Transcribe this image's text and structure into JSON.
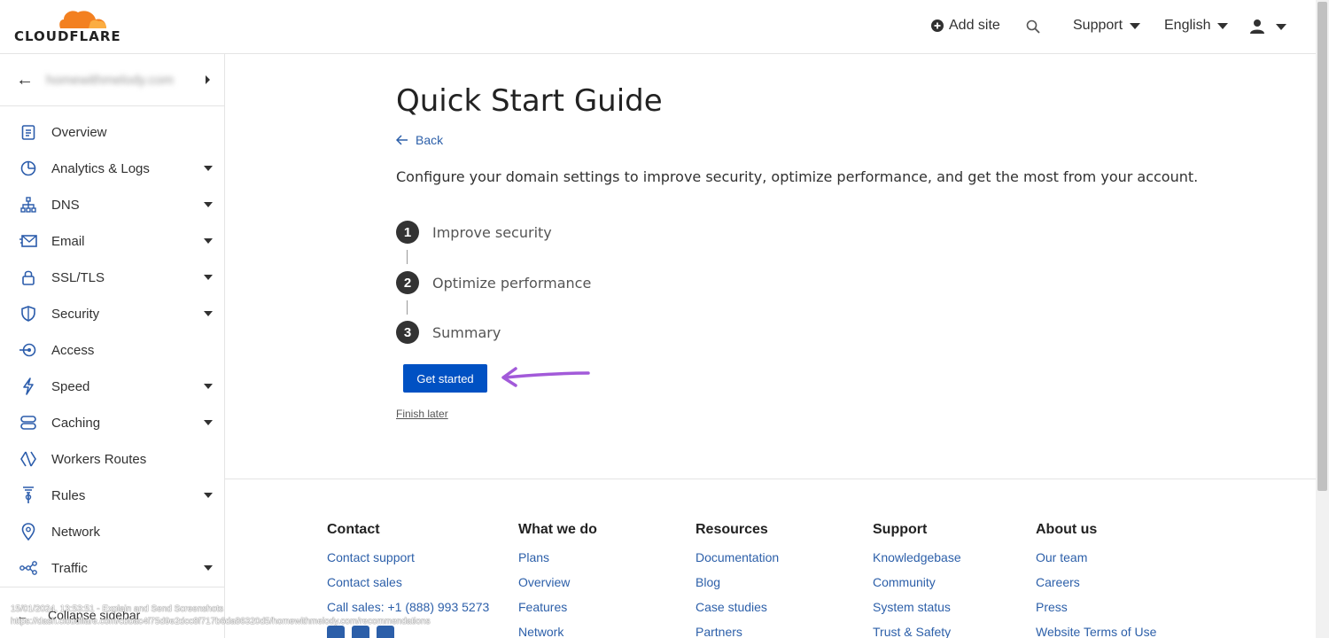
{
  "header": {
    "logo_text": "CLOUDFLARE",
    "add_site": "Add site",
    "support": "Support",
    "language": "English"
  },
  "sidebar": {
    "account_name": "homewithmelody.com",
    "items": [
      {
        "label": "Overview",
        "icon": "clipboard-icon",
        "has_caret": false
      },
      {
        "label": "Analytics & Logs",
        "icon": "pie-chart-icon",
        "has_caret": true
      },
      {
        "label": "DNS",
        "icon": "network-tree-icon",
        "has_caret": true
      },
      {
        "label": "Email",
        "icon": "envelope-icon",
        "has_caret": true
      },
      {
        "label": "SSL/TLS",
        "icon": "lock-icon",
        "has_caret": true
      },
      {
        "label": "Security",
        "icon": "shield-icon",
        "has_caret": true
      },
      {
        "label": "Access",
        "icon": "access-icon",
        "has_caret": false
      },
      {
        "label": "Speed",
        "icon": "lightning-icon",
        "has_caret": true
      },
      {
        "label": "Caching",
        "icon": "server-icon",
        "has_caret": true
      },
      {
        "label": "Workers Routes",
        "icon": "diamond-icon",
        "has_caret": false
      },
      {
        "label": "Rules",
        "icon": "funnel-icon",
        "has_caret": true
      },
      {
        "label": "Network",
        "icon": "map-pin-icon",
        "has_caret": false
      },
      {
        "label": "Traffic",
        "icon": "share-nodes-icon",
        "has_caret": true
      }
    ],
    "collapse_label": "Collapse sidebar"
  },
  "watermark": {
    "line1": "15/01/2024, 13:53:51 - Explain and Send Screenshots",
    "line2": "https://dash.cloudflare.com/cbbac4f75d9e2dcc8f717b6da86320d5/homewithmelody.com/recommendations"
  },
  "main": {
    "title": "Quick Start Guide",
    "back_label": "Back",
    "intro": "Configure your domain settings to improve security, optimize performance, and get the most from your account.",
    "steps": [
      {
        "num": "1",
        "label": "Improve security"
      },
      {
        "num": "2",
        "label": "Optimize performance"
      },
      {
        "num": "3",
        "label": "Summary"
      }
    ],
    "get_started": "Get started",
    "finish_later": "Finish later",
    "annotation_arrow_color": "#a25ad9"
  },
  "footer": {
    "columns": [
      {
        "heading": "Contact",
        "links": [
          "Contact support",
          "Contact sales",
          "Call sales: +1 (888) 993 5273"
        ]
      },
      {
        "heading": "What we do",
        "links": [
          "Plans",
          "Overview",
          "Features",
          "Network"
        ]
      },
      {
        "heading": "Resources",
        "links": [
          "Documentation",
          "Blog",
          "Case studies",
          "Partners"
        ]
      },
      {
        "heading": "Support",
        "links": [
          "Knowledgebase",
          "Community",
          "System status",
          "Trust & Safety"
        ]
      },
      {
        "heading": "About us",
        "links": [
          "Our team",
          "Careers",
          "Press",
          "Website Terms of Use"
        ]
      }
    ]
  },
  "colors": {
    "brand_orange": "#f38020",
    "link_blue": "#2c5fa9",
    "primary_button": "#0051c3"
  }
}
